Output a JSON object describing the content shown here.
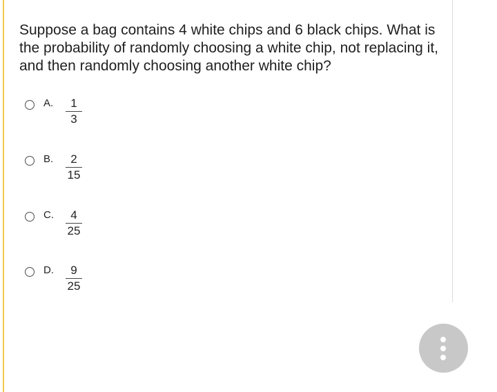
{
  "question": {
    "text": "Suppose a bag contains 4 white chips and 6 black chips. What is the probability of randomly choosing a white chip, not replacing it, and then randomly choosing another white chip?"
  },
  "choices": [
    {
      "letter": "A.",
      "numerator": "1",
      "denominator": "3"
    },
    {
      "letter": "B.",
      "numerator": "2",
      "denominator": "15"
    },
    {
      "letter": "C.",
      "numerator": "4",
      "denominator": "25"
    },
    {
      "letter": "D.",
      "numerator": "9",
      "denominator": "25"
    }
  ],
  "colors": {
    "left_accent": "#f2c84b",
    "more_button": "#c8c8c8"
  },
  "icons": {
    "more": "more-vertical-icon"
  }
}
